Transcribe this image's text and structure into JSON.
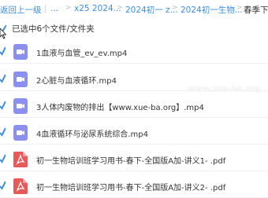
{
  "breadcrumb": {
    "back": "返回上一级",
    "divider": "|",
    "items": [
      "...",
      "x25 2024...",
      "2024初一 z...",
      "2024初一生物..."
    ],
    "current": "春季下"
  },
  "selection": {
    "status_text": "已选中6个文件/文件夹"
  },
  "files": [
    {
      "name": "1血液与血管_ev_ev.mp4",
      "type": "video",
      "icon": "video-icon"
    },
    {
      "name": "2心脏与血液循环.mp4",
      "type": "video",
      "icon": "video-icon"
    },
    {
      "name": "3人体内废物的排出【www.xue-ba.org】.mp4",
      "type": "video",
      "icon": "video-icon"
    },
    {
      "name": "4血液循环与泌尿系统综合.mp4",
      "type": "video",
      "icon": "video-icon"
    },
    {
      "name": "初一生物培训班学习用书-春下-全国版A加-讲义1- .pdf",
      "type": "pdf",
      "icon": "pdf-icon"
    },
    {
      "name": "初一生物培训班学习用书-春下-全国版A加-讲义2- .pdf",
      "type": "pdf",
      "icon": "pdf-icon"
    }
  ],
  "watermark": "www.xue-ba.org",
  "colors": {
    "accent": "#3a8ee6",
    "video_icon": "#8a8ff0",
    "pdf_icon": "#e85a5a"
  }
}
